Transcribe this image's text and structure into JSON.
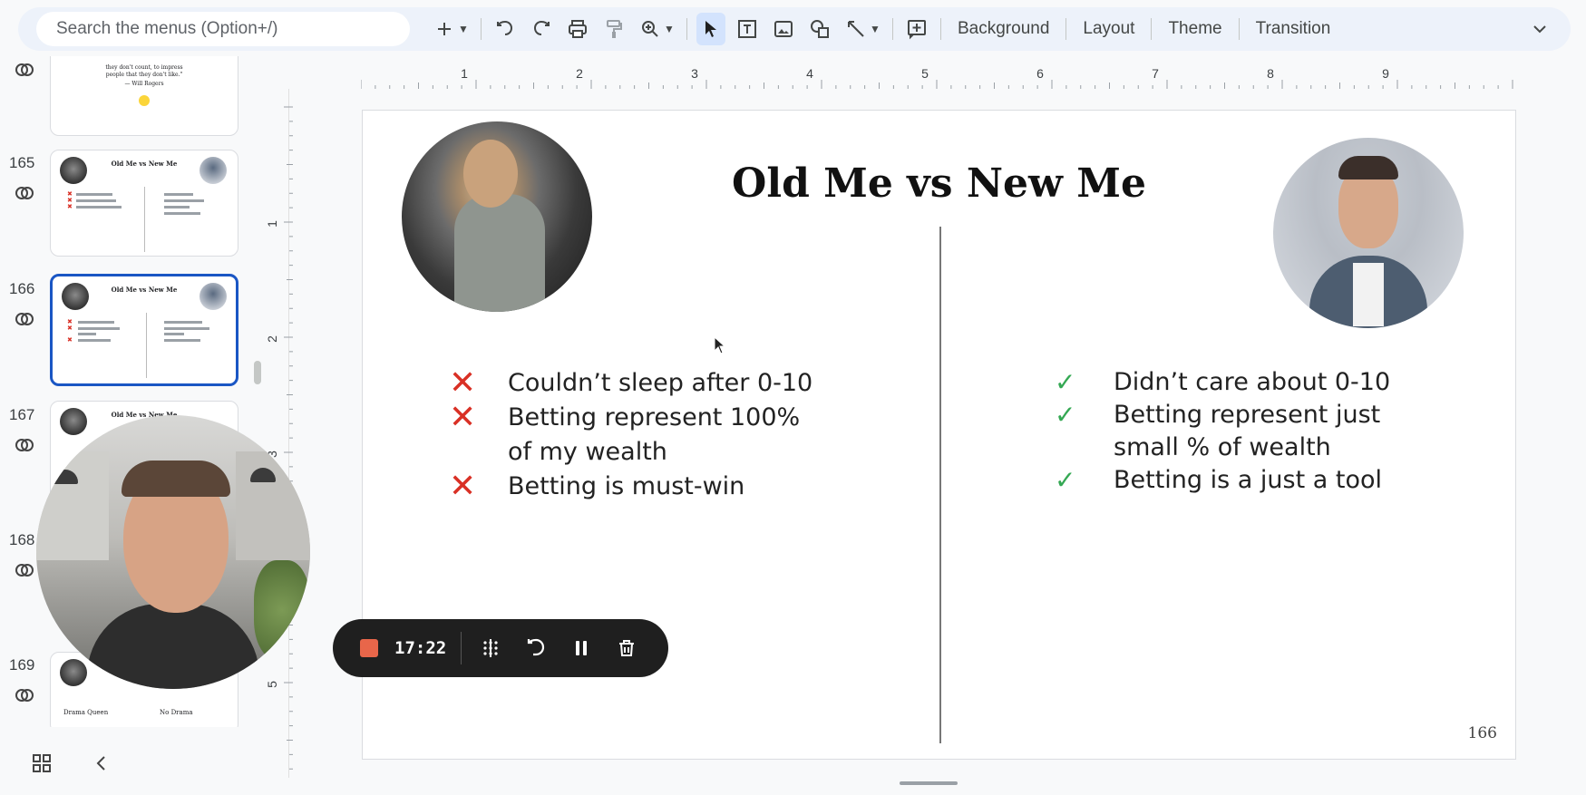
{
  "toolbar": {
    "search_placeholder": "Search the menus (Option+/)",
    "background_label": "Background",
    "layout_label": "Layout",
    "theme_label": "Theme",
    "transition_label": "Transition",
    "icons": [
      "plus-icon",
      "caret-down-icon",
      "undo-icon",
      "redo-icon",
      "print-icon",
      "paint-format-icon",
      "zoom-icon",
      "select-icon",
      "text-box-icon",
      "image-icon",
      "shape-icon",
      "line-icon",
      "new-comment-icon",
      "chevron-down-icon"
    ]
  },
  "filmstrip": {
    "slides": [
      {
        "number": "",
        "quote_line1": "they don't count, to impress",
        "quote_line2": "people that they don't like.\"",
        "quote_author": "— Will Rogers"
      },
      {
        "number": "165",
        "title": "Old Me vs New Me"
      },
      {
        "number": "166",
        "title": "Old Me vs New Me",
        "selected": true
      },
      {
        "number": "167",
        "title": "Old Me vs New Me"
      },
      {
        "number": "168"
      },
      {
        "number": "169",
        "left_text": "Drama Queen",
        "right_text": "No Drama"
      }
    ]
  },
  "ruler": {
    "top_ticks": [
      "1",
      "2",
      "3",
      "4",
      "5",
      "6",
      "7",
      "8",
      "9"
    ],
    "left_ticks": [
      "1",
      "2",
      "3",
      "4",
      "5"
    ]
  },
  "slide": {
    "title": "Old Me vs New Me",
    "old_me": [
      "Couldn’t sleep after 0-10",
      "Betting represent 100% of my wealth",
      "Betting is must-win"
    ],
    "new_me": [
      "Didn’t care about 0-10",
      "Betting represent just small % of wealth",
      "Betting is a just a tool"
    ],
    "page_number": "166"
  },
  "recording": {
    "time": "17:22",
    "stop_color": "#e8664a"
  },
  "colors": {
    "accent": "#1a56c4",
    "x_mark": "#d93025",
    "check_mark": "#34a853"
  }
}
